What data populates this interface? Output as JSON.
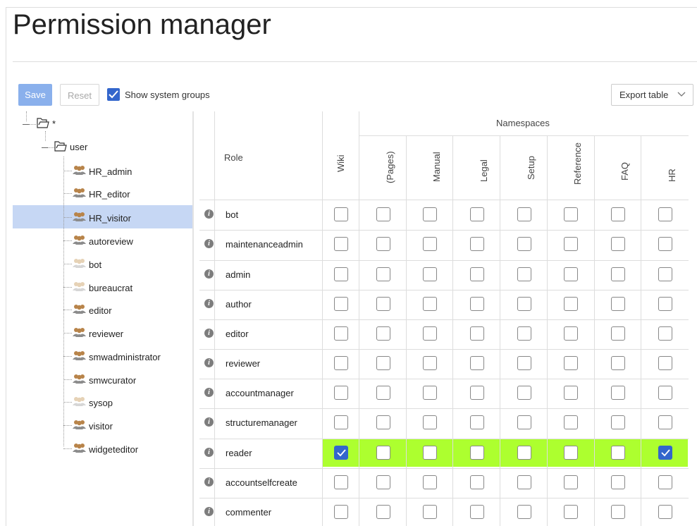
{
  "page": {
    "title": "Permission manager"
  },
  "toolbar": {
    "save_label": "Save",
    "reset_label": "Reset",
    "show_system_groups_label": "Show system groups",
    "show_system_groups_checked": true,
    "export_label": "Export table"
  },
  "tree": {
    "root_label": "*",
    "user_label": "user",
    "groups": [
      {
        "label": "HR_admin",
        "system": false
      },
      {
        "label": "HR_editor",
        "system": false
      },
      {
        "label": "HR_visitor",
        "system": false,
        "selected": true
      },
      {
        "label": "autoreview",
        "system": false
      },
      {
        "label": "bot",
        "system": true
      },
      {
        "label": "bureaucrat",
        "system": true
      },
      {
        "label": "editor",
        "system": false
      },
      {
        "label": "reviewer",
        "system": false
      },
      {
        "label": "smwadministrator",
        "system": false
      },
      {
        "label": "smwcurator",
        "system": false
      },
      {
        "label": "sysop",
        "system": true
      },
      {
        "label": "visitor",
        "system": false
      },
      {
        "label": "widgeteditor",
        "system": false
      }
    ]
  },
  "table": {
    "role_header": "Role",
    "wiki_header": "Wiki",
    "namespaces_header": "Namespaces",
    "namespaces": [
      "(Pages)",
      "Manual",
      "Legal",
      "Setup",
      "Reference",
      "FAQ",
      "HR"
    ],
    "rows": [
      {
        "role": "bot",
        "checks": [
          false,
          false,
          false,
          false,
          false,
          false,
          false,
          false
        ]
      },
      {
        "role": "maintenanceadmin",
        "checks": [
          false,
          false,
          false,
          false,
          false,
          false,
          false,
          false
        ]
      },
      {
        "role": "admin",
        "checks": [
          false,
          false,
          false,
          false,
          false,
          false,
          false,
          false
        ]
      },
      {
        "role": "author",
        "checks": [
          false,
          false,
          false,
          false,
          false,
          false,
          false,
          false
        ]
      },
      {
        "role": "editor",
        "checks": [
          false,
          false,
          false,
          false,
          false,
          false,
          false,
          false
        ]
      },
      {
        "role": "reviewer",
        "checks": [
          false,
          false,
          false,
          false,
          false,
          false,
          false,
          false
        ]
      },
      {
        "role": "accountmanager",
        "checks": [
          false,
          false,
          false,
          false,
          false,
          false,
          false,
          false
        ]
      },
      {
        "role": "structuremanager",
        "checks": [
          false,
          false,
          false,
          false,
          false,
          false,
          false,
          false
        ]
      },
      {
        "role": "reader",
        "checks": [
          true,
          false,
          false,
          false,
          false,
          false,
          false,
          true
        ],
        "highlighted": true
      },
      {
        "role": "accountselfcreate",
        "checks": [
          false,
          false,
          false,
          false,
          false,
          false,
          false,
          false
        ]
      },
      {
        "role": "commenter",
        "checks": [
          false,
          false,
          false,
          false,
          false,
          false,
          false,
          false
        ]
      }
    ]
  },
  "colors": {
    "accent": "#3366cc",
    "highlight_row": "#adff2f",
    "selected_tree": "#c6d7f4"
  }
}
